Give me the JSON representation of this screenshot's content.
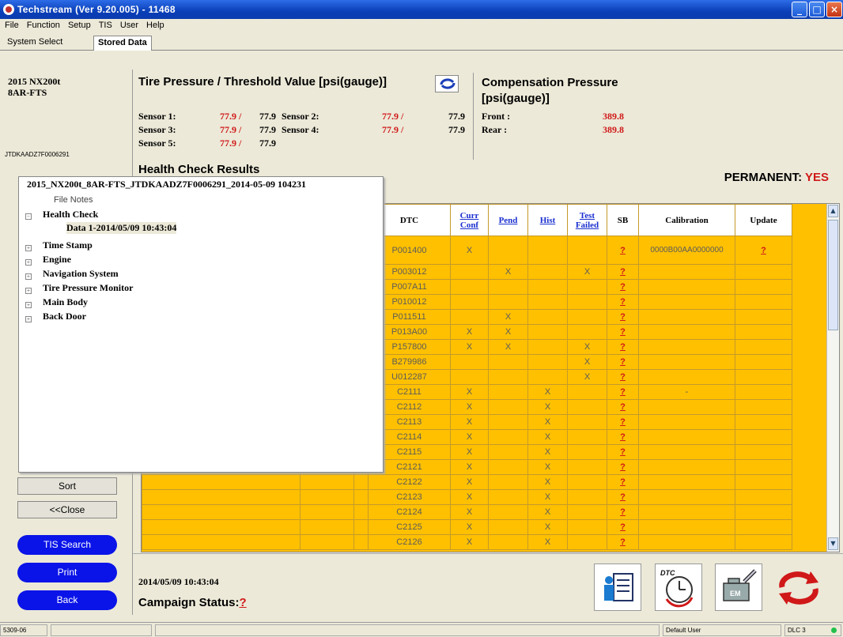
{
  "window": {
    "title": "Techstream (Ver 9.20.005) - 11468"
  },
  "menu": [
    "File",
    "Function",
    "Setup",
    "TIS",
    "User",
    "Help"
  ],
  "tabs": [
    "System Select",
    "Stored Data"
  ],
  "vehicle": {
    "model": "2015 NX200t",
    "engine": "8AR-FTS",
    "vin": "JTDKAADZ7F0006291"
  },
  "tire_pressure": {
    "title": "Tire Pressure / Threshold Value [psi(gauge)]",
    "sensors": [
      {
        "label": "Sensor 1:",
        "value": "77.9 /",
        "threshold": "77.9"
      },
      {
        "label": "Sensor 2:",
        "value": "77.9 /",
        "threshold": "77.9"
      },
      {
        "label": "Sensor 3:",
        "value": "77.9 /",
        "threshold": "77.9"
      },
      {
        "label": "Sensor 4:",
        "value": "77.9 /",
        "threshold": "77.9"
      },
      {
        "label": "Sensor 5:",
        "value": "77.9 /",
        "threshold": "77.9"
      }
    ]
  },
  "compensation": {
    "title_line1": "Compensation Pressure",
    "title_line2": "[psi(gauge)]",
    "front_label": "Front :",
    "front_value": "389.8",
    "rear_label": "Rear :",
    "rear_value": "389.8"
  },
  "health_check": {
    "title": "Health Check Results",
    "permanent_label": "PERMANENT:",
    "permanent_value": "YES"
  },
  "table": {
    "headers": {
      "dtc": "DTC",
      "curr": "Curr Conf",
      "pend": "Pend",
      "hist": "Hist",
      "test": "Test Failed",
      "sb": "SB",
      "calibration": "Calibration",
      "update": "Update"
    },
    "rows": [
      {
        "dtc": "P001400",
        "curr": "X",
        "pend": "",
        "hist": "",
        "test": "",
        "sb": "?",
        "calibration": "0000B00AA0000000",
        "update": "?"
      },
      {
        "dtc": "P003012",
        "curr": "",
        "pend": "X",
        "hist": "",
        "test": "X",
        "sb": "?",
        "calibration": "",
        "update": ""
      },
      {
        "dtc": "P007A11",
        "curr": "",
        "pend": "",
        "hist": "",
        "test": "",
        "sb": "?",
        "calibration": "",
        "update": ""
      },
      {
        "dtc": "P010012",
        "curr": "",
        "pend": "",
        "hist": "",
        "test": "",
        "sb": "?",
        "calibration": "",
        "update": ""
      },
      {
        "dtc": "P011511",
        "curr": "",
        "pend": "X",
        "hist": "",
        "test": "",
        "sb": "?",
        "calibration": "",
        "update": ""
      },
      {
        "dtc": "P013A00",
        "curr": "X",
        "pend": "X",
        "hist": "",
        "test": "",
        "sb": "?",
        "calibration": "",
        "update": ""
      },
      {
        "dtc": "P157800",
        "curr": "X",
        "pend": "X",
        "hist": "",
        "test": "X",
        "sb": "?",
        "calibration": "",
        "update": ""
      },
      {
        "dtc": "B279986",
        "curr": "",
        "pend": "",
        "hist": "",
        "test": "X",
        "sb": "?",
        "calibration": "",
        "update": ""
      },
      {
        "dtc": "U012287",
        "curr": "",
        "pend": "",
        "hist": "",
        "test": "X",
        "sb": "?",
        "calibration": "",
        "update": ""
      },
      {
        "dtc": "C2111",
        "curr": "X",
        "pend": "",
        "hist": "X",
        "test": "",
        "sb": "?",
        "calibration": "-",
        "update": ""
      },
      {
        "dtc": "C2112",
        "curr": "X",
        "pend": "",
        "hist": "X",
        "test": "",
        "sb": "?",
        "calibration": "",
        "update": ""
      },
      {
        "dtc": "C2113",
        "curr": "X",
        "pend": "",
        "hist": "X",
        "test": "",
        "sb": "?",
        "calibration": "",
        "update": ""
      },
      {
        "dtc": "C2114",
        "curr": "X",
        "pend": "",
        "hist": "X",
        "test": "",
        "sb": "?",
        "calibration": "",
        "update": ""
      },
      {
        "dtc": "C2115",
        "curr": "X",
        "pend": "",
        "hist": "X",
        "test": "",
        "sb": "?",
        "calibration": "",
        "update": ""
      },
      {
        "dtc": "C2121",
        "curr": "X",
        "pend": "",
        "hist": "X",
        "test": "",
        "sb": "?",
        "calibration": "",
        "update": ""
      },
      {
        "dtc": "C2122",
        "curr": "X",
        "pend": "",
        "hist": "X",
        "test": "",
        "sb": "?",
        "calibration": "",
        "update": ""
      },
      {
        "dtc": "C2123",
        "curr": "X",
        "pend": "",
        "hist": "X",
        "test": "",
        "sb": "?",
        "calibration": "",
        "update": ""
      },
      {
        "dtc": "C2124",
        "curr": "X",
        "pend": "",
        "hist": "X",
        "test": "",
        "sb": "?",
        "calibration": "",
        "update": ""
      },
      {
        "dtc": "C2125",
        "curr": "X",
        "pend": "",
        "hist": "X",
        "test": "",
        "sb": "?",
        "calibration": "",
        "update": ""
      },
      {
        "dtc": "C2126",
        "curr": "X",
        "pend": "",
        "hist": "X",
        "test": "",
        "sb": "?",
        "calibration": "",
        "update": ""
      }
    ]
  },
  "tree": {
    "header": "2015_NX200t_8AR-FTS_JTDKAADZ7F0006291_2014-05-09 104231",
    "file_notes": "File Notes",
    "health_check": "Health Check",
    "data_entry": "Data 1-2014/05/09 10:43:04",
    "items": [
      "Time Stamp",
      "Engine",
      "Navigation System",
      "Tire Pressure Monitor",
      "Main Body",
      "Back Door"
    ]
  },
  "buttons": {
    "sort": "Sort",
    "close": "<<Close",
    "tis_search": "TIS Search",
    "print": "Print",
    "back": "Back"
  },
  "bottom": {
    "date": "2014/05/09 10:43:04",
    "campaign_label": "Campaign Status:",
    "campaign_value": "?"
  },
  "status": {
    "left": "5309-06",
    "user": "Default User",
    "dlc": "DLC 3"
  },
  "colors": {
    "table_bg": "#ffc000",
    "button_blue": "#0a14e8",
    "accent_red": "#d01818",
    "link_blue": "#1a2fd0"
  }
}
